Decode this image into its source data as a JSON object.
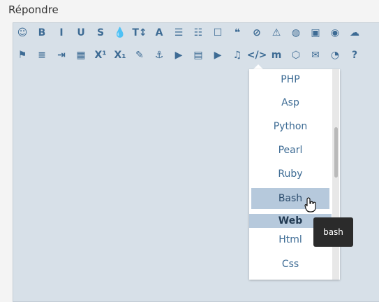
{
  "title": "Répondre",
  "toolbar_row1": [
    {
      "icon": "smiley-icon",
      "glyph": "☺"
    },
    {
      "icon": "bold-icon",
      "glyph": "B"
    },
    {
      "icon": "italic-icon",
      "glyph": "I"
    },
    {
      "icon": "underline-icon",
      "glyph": "U"
    },
    {
      "icon": "strikethrough-icon",
      "glyph": "S"
    },
    {
      "icon": "color-drop-icon",
      "glyph": "💧"
    },
    {
      "icon": "font-size-icon",
      "glyph": "T↕"
    },
    {
      "icon": "font-icon",
      "glyph": "A"
    },
    {
      "icon": "ordered-list-icon",
      "glyph": "☰"
    },
    {
      "icon": "bullet-list-icon",
      "glyph": "☷"
    },
    {
      "icon": "box-icon",
      "glyph": "☐"
    },
    {
      "icon": "quote-icon",
      "glyph": "❝"
    },
    {
      "icon": "spoiler-icon",
      "glyph": "⊘"
    },
    {
      "icon": "warning-icon",
      "glyph": "⚠"
    },
    {
      "icon": "globe-icon",
      "glyph": "◍"
    },
    {
      "icon": "image-icon",
      "glyph": "▣"
    },
    {
      "icon": "camera-icon",
      "glyph": "◉"
    },
    {
      "icon": "upload-icon",
      "glyph": "☁"
    }
  ],
  "toolbar_row2": [
    {
      "icon": "flag-icon",
      "glyph": "⚑"
    },
    {
      "icon": "align-left-icon",
      "glyph": "≡"
    },
    {
      "icon": "indent-icon",
      "glyph": "⇥"
    },
    {
      "icon": "table-icon",
      "glyph": "▦"
    },
    {
      "icon": "superscript-icon",
      "glyph": "X¹"
    },
    {
      "icon": "subscript-icon",
      "glyph": "X₁"
    },
    {
      "icon": "brush-icon",
      "glyph": "✎"
    },
    {
      "icon": "anchor-icon",
      "glyph": "⚓"
    },
    {
      "icon": "play-icon",
      "glyph": "▶"
    },
    {
      "icon": "film-icon",
      "glyph": "▤"
    },
    {
      "icon": "youtube-icon",
      "glyph": "▶"
    },
    {
      "icon": "music-icon",
      "glyph": "♫"
    },
    {
      "icon": "code-icon",
      "glyph": "</>"
    },
    {
      "icon": "math-icon",
      "glyph": "m"
    },
    {
      "icon": "html5-icon",
      "glyph": "⬡"
    },
    {
      "icon": "envelope-icon",
      "glyph": "✉"
    },
    {
      "icon": "rss-icon",
      "glyph": "◔"
    },
    {
      "icon": "help-icon",
      "glyph": "?"
    }
  ],
  "dropdown": {
    "items": [
      "PHP",
      "Asp",
      "Python",
      "Pearl",
      "Ruby",
      "Bash"
    ],
    "hovered": "Bash",
    "section_header": "Web",
    "items_after": [
      "Html",
      "Css"
    ]
  },
  "tooltip": "bash",
  "colors": {
    "accent": "#3d6b94",
    "editor_bg": "#d7e0e8",
    "highlight": "#b6c9dc",
    "tooltip_bg": "#2b2b2b"
  }
}
